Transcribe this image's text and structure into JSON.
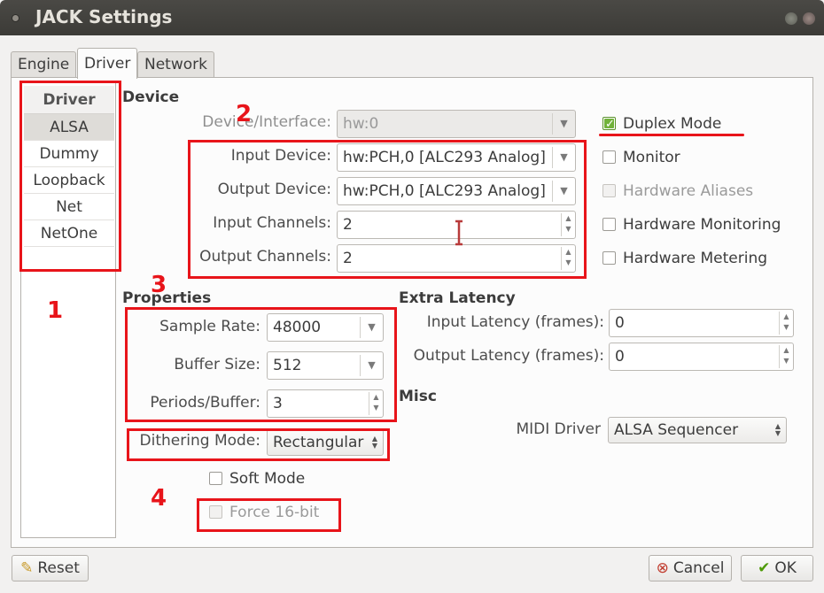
{
  "window": {
    "title": "JACK Settings"
  },
  "tabs": [
    {
      "label": "Engine"
    },
    {
      "label": "Driver"
    },
    {
      "label": "Network"
    }
  ],
  "driver_list": {
    "header": "Driver",
    "items": [
      {
        "label": "ALSA"
      },
      {
        "label": "Dummy"
      },
      {
        "label": "Loopback"
      },
      {
        "label": "Net"
      },
      {
        "label": "NetOne"
      }
    ],
    "selected": "ALSA"
  },
  "device": {
    "section": "Device",
    "interface_label": "Device/Interface:",
    "interface_value": "hw:0",
    "input_device_label": "Input Device:",
    "input_device_value": "hw:PCH,0 [ALC293 Analog]",
    "output_device_label": "Output Device:",
    "output_device_value": "hw:PCH,0 [ALC293 Analog]",
    "input_channels_label": "Input Channels:",
    "input_channels_value": "2",
    "output_channels_label": "Output Channels:",
    "output_channels_value": "2"
  },
  "options": {
    "duplex": "Duplex Mode",
    "monitor": "Monitor",
    "hw_aliases": "Hardware Aliases",
    "hw_monitoring": "Hardware Monitoring",
    "hw_metering": "Hardware Metering"
  },
  "properties": {
    "section": "Properties",
    "sample_rate_label": "Sample Rate:",
    "sample_rate_value": "48000",
    "buffer_size_label": "Buffer Size:",
    "buffer_size_value": "512",
    "periods_label": "Periods/Buffer:",
    "periods_value": "3",
    "dithering_label": "Dithering Mode:",
    "dithering_value": "Rectangular",
    "soft_mode": "Soft Mode",
    "force16": "Force 16-bit"
  },
  "latency": {
    "section": "Extra Latency",
    "input_label": "Input Latency (frames):",
    "input_value": "0",
    "output_label": "Output Latency (frames):",
    "output_value": "0"
  },
  "misc": {
    "section": "Misc",
    "midi_label": "MIDI Driver",
    "midi_value": "ALSA Sequencer"
  },
  "buttons": {
    "reset": "Reset",
    "cancel": "Cancel",
    "ok": "OK"
  },
  "annotations": [
    "1",
    "2",
    "3",
    "4"
  ],
  "colors": {
    "annotation": "#e8141a",
    "check_on": "#71b23a",
    "titlebar": "#3c3b37"
  }
}
